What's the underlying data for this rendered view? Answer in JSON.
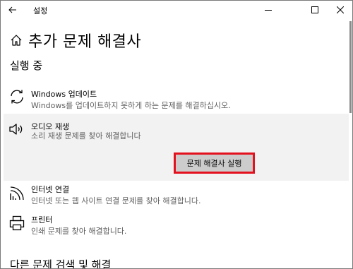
{
  "window": {
    "app_title": "설정",
    "controls": {
      "minimize": "minimize-icon",
      "maximize": "maximize-icon",
      "close": "close-icon"
    }
  },
  "header": {
    "title": "추가 문제 해결사",
    "icon": "home-icon"
  },
  "sections": {
    "running": "실행 중",
    "other": "다른 문제 검색 및 해결"
  },
  "items": [
    {
      "title": "Windows 업데이트",
      "desc": "Windows를 업데이트하지 못하게 하는 문제를 해결하십시오.",
      "icon": "refresh-icon"
    },
    {
      "title": "오디오 재생",
      "desc": "소리 재생 문제를 찾아 해결합니다",
      "icon": "speaker-icon",
      "button": "문제 해결사 실행"
    },
    {
      "title": "인터넷 연결",
      "desc": "인터넷 또는 웹 사이트 연결 문제를 찾아 해결합니다.",
      "icon": "wifi-icon"
    },
    {
      "title": "프린터",
      "desc": "인쇄 문제를 찾아 해결합니다.",
      "icon": "printer-icon"
    }
  ],
  "colors": {
    "highlight_border": "#e3101d",
    "button_bg": "#cccccc",
    "selected_row_bg": "#f2f2f2"
  }
}
